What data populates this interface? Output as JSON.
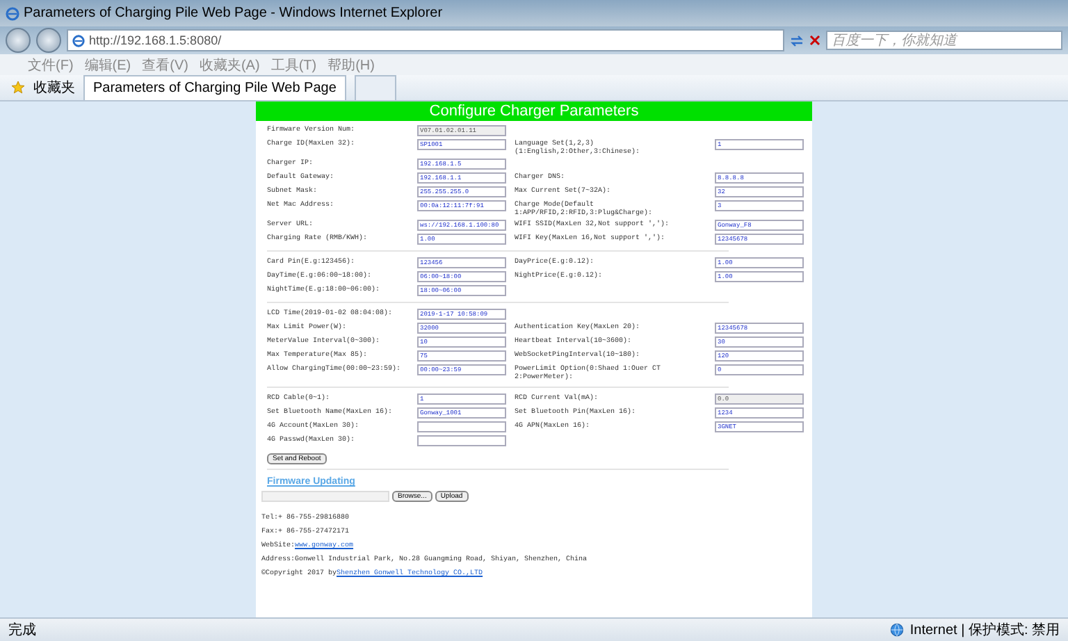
{
  "window": {
    "title": "Parameters of Charging Pile Web Page - Windows Internet Explorer"
  },
  "address_bar": {
    "url": "http://192.168.1.5:8080/"
  },
  "search": {
    "placeholder": "百度一下，你就知道"
  },
  "menu": [
    "文件(F)",
    "编辑(E)",
    "查看(V)",
    "收藏夹(A)",
    "工具(T)",
    "帮助(H)"
  ],
  "favorites": {
    "label": "收藏夹"
  },
  "tabs": [
    {
      "label": "Parameters of Charging Pile Web Page",
      "selected": true
    },
    {
      "selected": false
    }
  ],
  "page": {
    "header": "Configure Charger Parameters",
    "sections": [
      {
        "rows": [
          {
            "left": {
              "label": "Firmware Version Num:",
              "value": "V07.01.02.01.11",
              "disabled": true
            }
          },
          {
            "left": {
              "label": "Charge ID(MaxLen 32):",
              "value": "SP1001",
              "disabled": false
            },
            "right": {
              "label": "Language Set(1,2,3)(1:English,2:Other,3:Chinese):",
              "value": "1",
              "disabled": false
            }
          },
          {
            "left": {
              "label": "Charger IP:",
              "value": "192.168.1.5",
              "disabled": false
            }
          },
          {
            "left": {
              "label": "Default Gateway:",
              "value": "192.168.1.1",
              "disabled": false
            },
            "right": {
              "label": "Charger DNS:",
              "value": "8.8.8.8",
              "disabled": false
            }
          },
          {
            "left": {
              "label": "Subnet Mask:",
              "value": "255.255.255.0",
              "disabled": false
            },
            "right": {
              "label": "Max Current Set(7~32A):",
              "value": "32",
              "disabled": false
            }
          },
          {
            "left": {
              "label": "Net Mac Address:",
              "value": "00:0a:12:11:7f:91",
              "disabled": false
            },
            "right": {
              "label": "Charge Mode(Default 1:APP/RFID,2:RFID,3:Plug&Charge):",
              "value": "3",
              "disabled": false
            }
          },
          {
            "left": {
              "label": "Server URL:",
              "value": "ws://192.168.1.100:80",
              "disabled": false
            },
            "right": {
              "label": "WIFI SSID(MaxLen 32,Not support ','):",
              "value": "Gonway_F8",
              "disabled": false
            }
          },
          {
            "left": {
              "label": "Charging Rate (RMB/KWH):",
              "value": "1.00",
              "disabled": false
            },
            "right": {
              "label": "WIFI Key(MaxLen 16,Not support ','):",
              "value": "12345678",
              "disabled": false
            }
          }
        ]
      },
      {
        "rows": [
          {
            "left": {
              "label": "Card Pin(E.g:123456):",
              "value": "123456",
              "disabled": false
            },
            "right": {
              "label": "DayPrice(E.g:0.12):",
              "value": "1.00",
              "disabled": false
            }
          },
          {
            "left": {
              "label": "DayTime(E.g:06:00~18:00):",
              "value": "06:00~18:00",
              "disabled": false
            },
            "right": {
              "label": "NightPrice(E.g:0.12):",
              "value": "1.00",
              "disabled": false
            }
          },
          {
            "left": {
              "label": "NightTime(E.g:18:00~06:00):",
              "value": "18:00~06:00",
              "disabled": false
            }
          }
        ]
      },
      {
        "rows": [
          {
            "left": {
              "label": "LCD Time(2019-01-02 08:04:08):",
              "value": "2019-1-17 10:58:09",
              "disabled": false
            }
          },
          {
            "left": {
              "label": "Max Limit Power(W):",
              "value": "32000",
              "disabled": false
            },
            "right": {
              "label": "Authentication Key(MaxLen 20):",
              "value": "12345678",
              "disabled": false
            }
          },
          {
            "left": {
              "label": "MeterValue Interval(0~300):",
              "value": "10",
              "disabled": false
            },
            "right": {
              "label": "Heartbeat Interval(10~3600):",
              "value": "30",
              "disabled": false
            }
          },
          {
            "left": {
              "label": "Max Temperature(Max 85):",
              "value": "75",
              "disabled": false
            },
            "right": {
              "label": "WebSocketPingInterval(10~180):",
              "value": "120",
              "disabled": false
            }
          },
          {
            "left": {
              "label": "Allow ChargingTime(00:00~23:59):",
              "value": "00:00~23:59",
              "disabled": false
            },
            "right": {
              "label": "PowerLimit Option(0:Shaed 1:Ouer CT 2:PowerMeter):",
              "value": "0",
              "disabled": false
            }
          }
        ]
      },
      {
        "rows": [
          {
            "left": {
              "label": "RCD Cable(0~1):",
              "value": "1",
              "disabled": false
            },
            "right": {
              "label": "RCD Current Val(mA):",
              "value": "0.0",
              "disabled": true
            }
          },
          {
            "left": {
              "label": "Set Bluetooth Name(MaxLen 16):",
              "value": "Gonway_1001",
              "disabled": false
            },
            "right": {
              "label": "Set Bluetooth Pin(MaxLen 16):",
              "value": "1234",
              "disabled": false
            }
          },
          {
            "left": {
              "label": "4G Account(MaxLen 30):",
              "disabled": false
            },
            "right": {
              "label": "4G APN(MaxLen 16):",
              "value": "3GNET",
              "disabled": false
            }
          },
          {
            "left": {
              "label": "4G Passwd(MaxLen 30):",
              "disabled": false
            }
          }
        ]
      }
    ],
    "submit": "Set and Reboot",
    "firmware": {
      "title": "Firmware Updating",
      "browse": "Browse...",
      "upload": "Upload"
    },
    "footer": [
      {
        "kind": "text",
        "text": "Tel:+ 86-755-29816880"
      },
      {
        "kind": "text",
        "text": "Fax:+ 86-755-27472171"
      },
      {
        "kind": "link",
        "text": "WebSite:",
        "link": "www.gonway.com"
      },
      {
        "kind": "text",
        "text": "Address:Gonwell Industrial Park, No.28 Guangming Road, Shiyan, Shenzhen, China"
      },
      {
        "kind": "link",
        "text": "©Copyright 2017 by",
        "link": "Shenzhen Gonwell Technology CO.,LTD"
      }
    ]
  },
  "status_bar": {
    "text": "完成",
    "zone": "Internet | 保护模式: 禁用"
  }
}
